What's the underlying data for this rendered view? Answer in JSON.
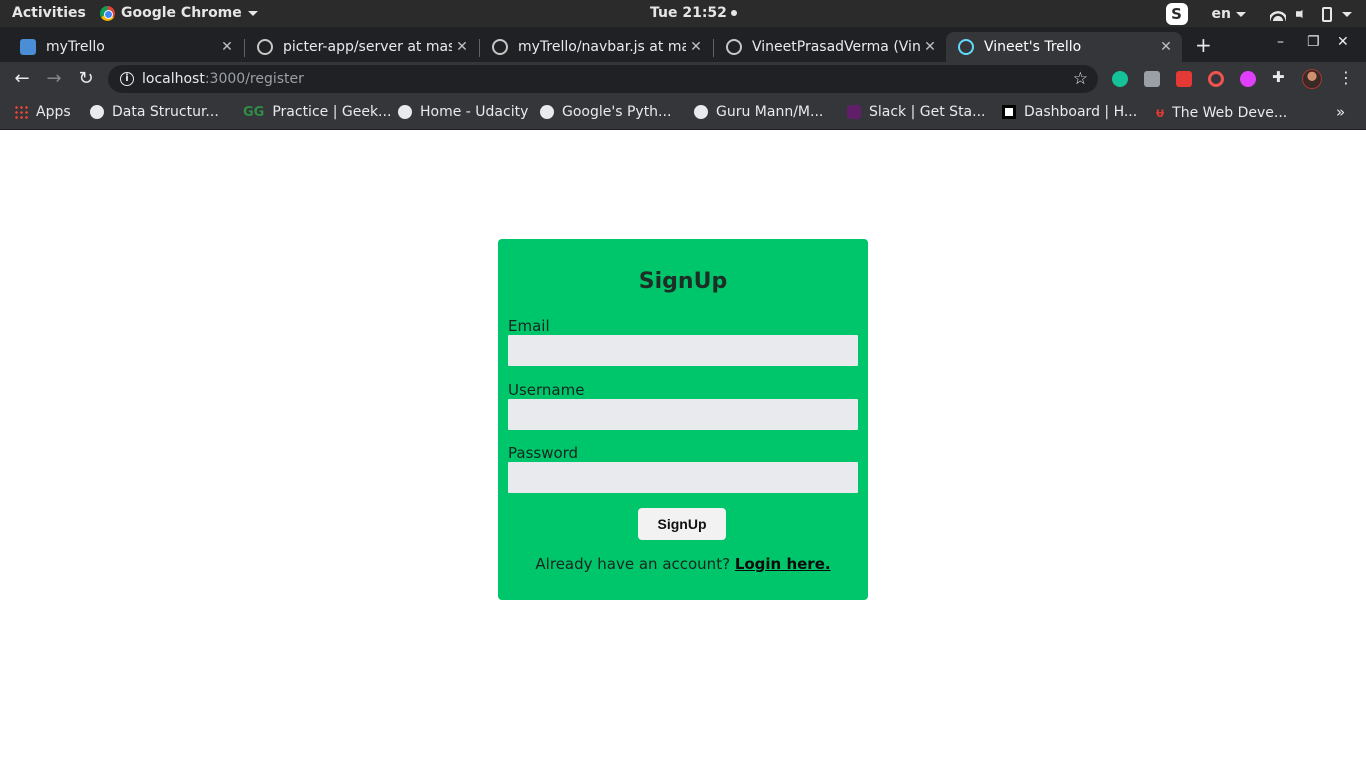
{
  "system": {
    "activities": "Activities",
    "app_name": "Google Chrome",
    "clock": "Tue 21:52",
    "skype": "S",
    "language": "en"
  },
  "tabs": [
    {
      "title": "myTrello",
      "icon": "trello-icon"
    },
    {
      "title": "picter-app/server at mast",
      "icon": "github-icon"
    },
    {
      "title": "myTrello/navbar.js at ma",
      "icon": "github-icon"
    },
    {
      "title": "VineetPrasadVerma (Vin",
      "icon": "github-icon"
    },
    {
      "title": "Vineet's Trello",
      "icon": "react-icon",
      "active": true
    }
  ],
  "window_controls": {
    "new_tab": "+",
    "minimize": "–",
    "restore": "❐",
    "close": "✕"
  },
  "address": {
    "host": "localhost",
    "path": ":3000/register"
  },
  "bookmarks": [
    {
      "label": "Apps",
      "icon": "apps-grid-icon"
    },
    {
      "label": "Data Structur...",
      "icon": "globe-icon"
    },
    {
      "label": "Practice | Geek...",
      "icon": "geeksforgeeks-icon"
    },
    {
      "label": "Home - Udacity",
      "icon": "globe-icon"
    },
    {
      "label": "Google's Pyth...",
      "icon": "globe-icon"
    },
    {
      "label": "Guru Mann/M...",
      "icon": "globe-icon"
    },
    {
      "label": "Slack | Get Sta...",
      "icon": "slack-icon"
    },
    {
      "label": "Dashboard | H...",
      "icon": "hackerearth-icon"
    },
    {
      "label": "The Web Deve...",
      "icon": "udemy-icon"
    }
  ],
  "form": {
    "title": "SignUp",
    "email_label": "Email",
    "username_label": "Username",
    "password_label": "Password",
    "submit_label": "SignUp",
    "footer_text": "Already have an account? ",
    "login_link": "Login here."
  },
  "colors": {
    "card": "#00c66b",
    "input": "#e9eaee",
    "chrome_dark": "#35363a"
  }
}
